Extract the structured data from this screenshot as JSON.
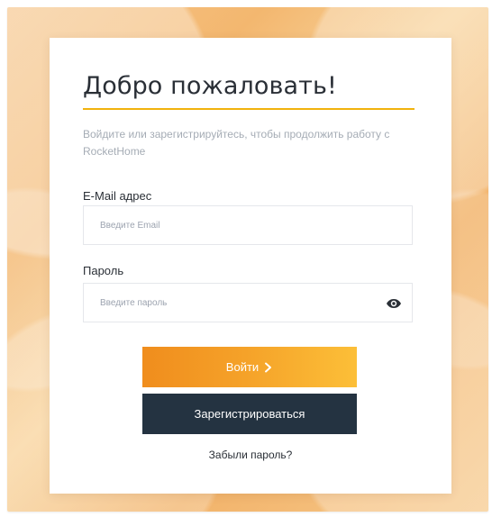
{
  "brand_colors": {
    "accent": "#F5A229",
    "rule": "#F1B20D",
    "register_bg": "#243341"
  },
  "login_form": {
    "title": "Добро пожаловать!",
    "subtitle": "Войдите или зарегистрируйтесь, чтобы продолжить работу с RocketHome",
    "email": {
      "label": "E-Mail адрес",
      "placeholder": "Введите Email",
      "value": ""
    },
    "password": {
      "label": "Пароль",
      "placeholder": "Введите пароль",
      "value": "",
      "toggle_icon": "eye-icon"
    },
    "login_button": {
      "label": "Войти",
      "icon": "chevron-right-icon"
    },
    "register_button": {
      "label": "Зарегистрироваться"
    },
    "forgot_password": {
      "label": "Забыли пароль?"
    }
  }
}
